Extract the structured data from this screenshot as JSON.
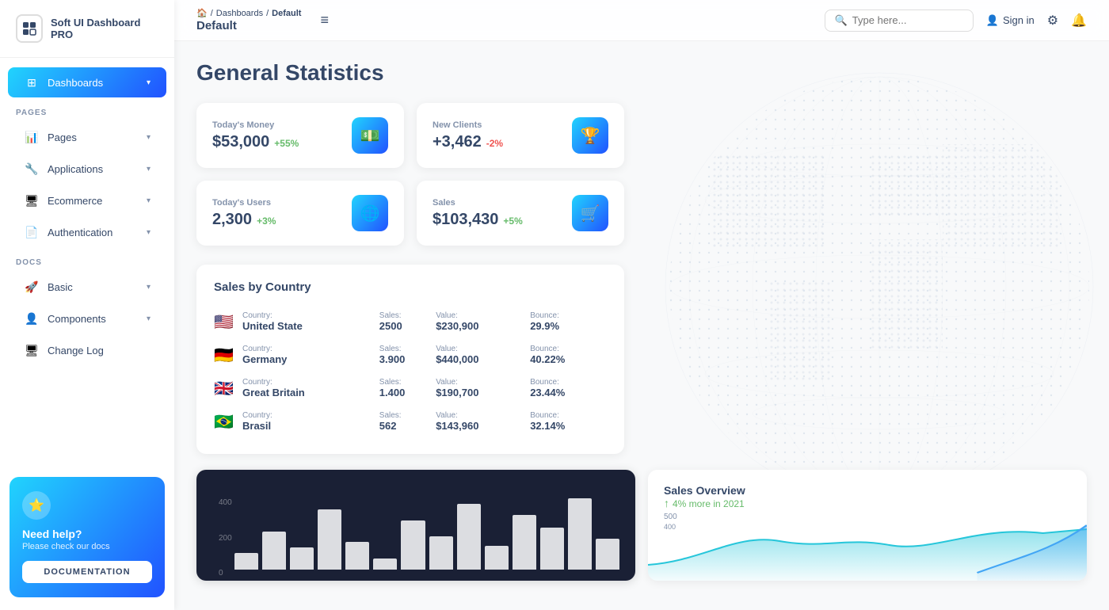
{
  "app": {
    "name": "Soft UI Dashboard PRO"
  },
  "breadcrumb": {
    "home_icon": "🏠",
    "path1": "Dashboards",
    "path2": "Default",
    "current": "Default"
  },
  "header": {
    "search_placeholder": "Type here...",
    "signin_label": "Sign in",
    "menu_icon": "≡"
  },
  "sidebar": {
    "section_pages": "PAGES",
    "section_docs": "DOCS",
    "items_pages": [
      {
        "id": "dashboards",
        "label": "Dashboards",
        "icon": "⊞",
        "active": true
      },
      {
        "id": "pages",
        "label": "Pages",
        "icon": "📊"
      },
      {
        "id": "applications",
        "label": "Applications",
        "icon": "🔧"
      },
      {
        "id": "ecommerce",
        "label": "Ecommerce",
        "icon": "🖥"
      },
      {
        "id": "authentication",
        "label": "Authentication",
        "icon": "📄"
      }
    ],
    "items_docs": [
      {
        "id": "basic",
        "label": "Basic",
        "icon": "🚀"
      },
      {
        "id": "components",
        "label": "Components",
        "icon": "👤"
      },
      {
        "id": "changelog",
        "label": "Change Log",
        "icon": "🖥"
      }
    ],
    "help": {
      "star_icon": "⭐",
      "title": "Need help?",
      "subtitle": "Please check our docs",
      "button_label": "DOCUMENTATION"
    }
  },
  "page": {
    "title": "General Statistics"
  },
  "stats": [
    {
      "label": "Today's Money",
      "value": "$53,000",
      "change": "+55%",
      "change_type": "positive",
      "icon": "💵"
    },
    {
      "label": "New Clients",
      "value": "+3,462",
      "change": "-2%",
      "change_type": "negative",
      "icon": "🏆"
    },
    {
      "label": "Today's Users",
      "value": "2,300",
      "change": "+3%",
      "change_type": "positive",
      "icon": "🌐"
    },
    {
      "label": "Sales",
      "value": "$103,430",
      "change": "+5%",
      "change_type": "positive",
      "icon": "🛒"
    }
  ],
  "sales_by_country": {
    "title": "Sales by Country",
    "columns": [
      "Country:",
      "Sales:",
      "Value:",
      "Bounce:"
    ],
    "rows": [
      {
        "flag": "🇺🇸",
        "country": "United State",
        "sales": "2500",
        "value": "$230,900",
        "bounce": "29.9%"
      },
      {
        "flag": "🇩🇪",
        "country": "Germany",
        "sales": "3.900",
        "value": "$440,000",
        "bounce": "40.22%"
      },
      {
        "flag": "🇬🇧",
        "country": "Great Britain",
        "sales": "1.400",
        "value": "$190,700",
        "bounce": "23.44%"
      },
      {
        "flag": "🇧🇷",
        "country": "Brasil",
        "sales": "562",
        "value": "$143,960",
        "bounce": "32.14%"
      }
    ]
  },
  "chart": {
    "y_labels": [
      "400",
      "200",
      "0"
    ],
    "bars": [
      15,
      35,
      20,
      55,
      25,
      10,
      45,
      30,
      60,
      22,
      50,
      38,
      65,
      28
    ]
  },
  "sales_overview": {
    "title": "Sales Overview",
    "subtitle": "4% more in 2021",
    "y_labels": [
      "500",
      "400"
    ]
  }
}
